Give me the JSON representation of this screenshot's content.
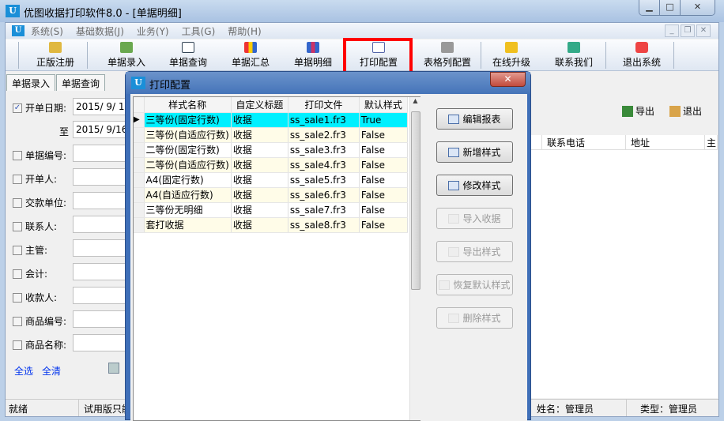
{
  "window": {
    "title": "优图收据打印软件8.0 - [单据明细]",
    "icon_text": "U"
  },
  "menu": [
    "系统(S)",
    "基础数据(J)",
    "业务(Y)",
    "工具(G)",
    "帮助(H)"
  ],
  "toolbar": [
    "正版注册",
    "单据录入",
    "单据查询",
    "单据汇总",
    "单据明细",
    "打印配置",
    "表格列配置",
    "在线升级",
    "联系我们",
    "退出系统"
  ],
  "tabs": [
    "单据录入",
    "单据查询"
  ],
  "filters": {
    "date_label": "开单日期:",
    "date_from": "2015/  9/  1",
    "to_label": "至",
    "date_to": "2015/  9/16",
    "fields": [
      "单据编号:",
      "开单人:",
      "交款单位:",
      "联系人:",
      "主管:",
      "会计:",
      "收款人:",
      "商品编号:",
      "商品名称:"
    ],
    "select_all": "全选",
    "clear_all": "全清"
  },
  "actions": {
    "export": "导出",
    "exit": "退出"
  },
  "main_grid": {
    "columns": [
      "联系电话",
      "地址",
      "主"
    ]
  },
  "status": {
    "ready": "就绪",
    "trial": "试用版只能",
    "user": "姓名：管理员",
    "type": "类型：管理员"
  },
  "dialog": {
    "title": "打印配置",
    "columns": [
      "样式名称",
      "自定义标题",
      "打印文件",
      "默认样式"
    ],
    "rows": [
      [
        "三等份(固定行数)",
        "收据",
        "ss_sale1.fr3",
        "True"
      ],
      [
        "三等份(自适应行数)",
        "收据",
        "ss_sale2.fr3",
        "False"
      ],
      [
        "二等份(固定行数)",
        "收据",
        "ss_sale3.fr3",
        "False"
      ],
      [
        "二等份(自适应行数)",
        "收据",
        "ss_sale4.fr3",
        "False"
      ],
      [
        "A4(固定行数)",
        "收据",
        "ss_sale5.fr3",
        "False"
      ],
      [
        "A4(自适应行数)",
        "收据",
        "ss_sale6.fr3",
        "False"
      ],
      [
        "三等份无明细",
        "收据",
        "ss_sale7.fr3",
        "False"
      ],
      [
        "套打收据",
        "收据",
        "ss_sale8.fr3",
        "False"
      ]
    ],
    "buttons": [
      "编辑报表",
      "新增样式",
      "修改样式",
      "导入收据",
      "导出样式",
      "恢复默认样式",
      "删除样式"
    ]
  }
}
